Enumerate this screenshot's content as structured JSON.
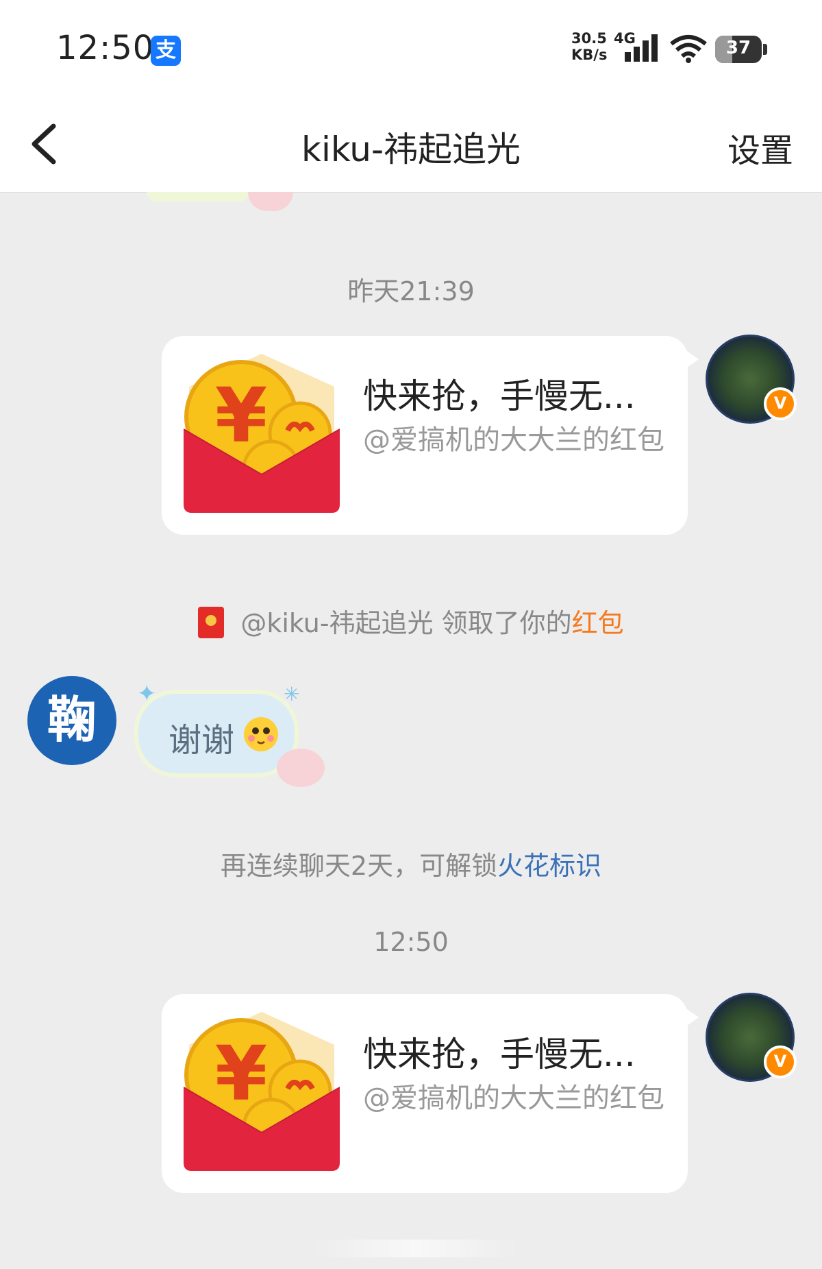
{
  "status_bar": {
    "time": "12:50",
    "net_speed_value": "30.5",
    "net_speed_unit": "KB/s",
    "network_type": "4G",
    "battery": "37",
    "battery_level_percent": 37,
    "wifi_label": "7"
  },
  "header": {
    "title": "kiku-祎起追光",
    "settings_label": "设置"
  },
  "chat": {
    "timestamp_1": "昨天21:39",
    "red_packet_1": {
      "title": "快来抢，手慢无...",
      "subtitle": "@爱搞机的大大兰的红包"
    },
    "system_notice": {
      "prefix": "@kiku-祎起追光 领取了你的",
      "link": "红包"
    },
    "reply_message": "谢谢",
    "other_avatar_glyph": "鞠",
    "streak_notice": {
      "prefix": "再连续聊天2天，可解锁",
      "link": "火花标识"
    },
    "timestamp_2": "12:50",
    "red_packet_2": {
      "title": "快来抢，手慢无...",
      "subtitle": "@爱搞机的大大兰的红包"
    },
    "verified_badge": "V"
  },
  "colors": {
    "accent_orange": "#f5791e",
    "link_blue": "#3a71b8",
    "red_packet_red": "#e32b28",
    "alipay_blue": "#1677ff"
  }
}
